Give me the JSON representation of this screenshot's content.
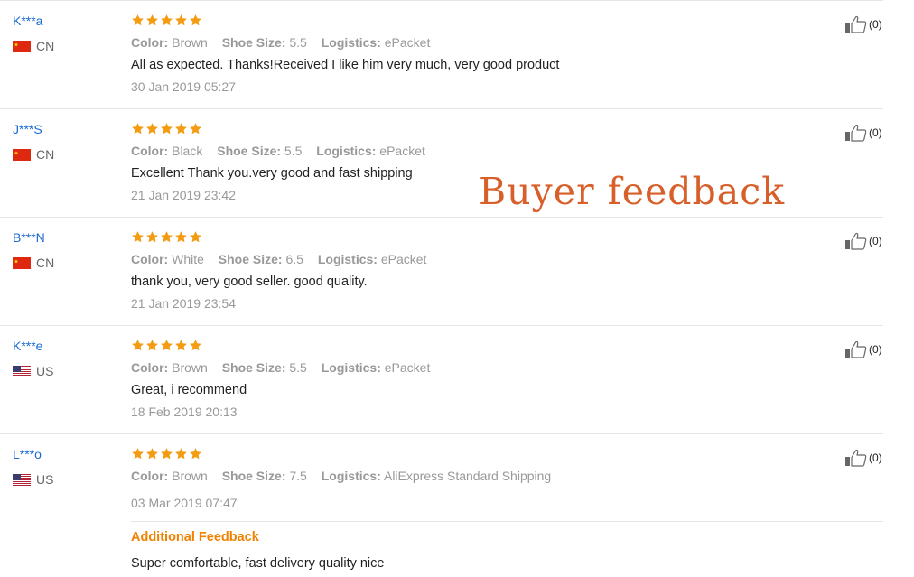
{
  "overlay_title": "Buyer feedback",
  "reviews": [
    {
      "user": "K***a",
      "country": "CN",
      "color": "Brown",
      "size": "5.5",
      "logistics": "ePacket",
      "text": "All as expected. Thanks!Received I like him very much, very good product",
      "date": "30 Jan 2019 05:27",
      "helpful": "(0)"
    },
    {
      "user": "J***S",
      "country": "CN",
      "color": "Black",
      "size": "5.5",
      "logistics": "ePacket",
      "text": "Excellent Thank you.very good and fast shipping",
      "date": "21 Jan 2019 23:42",
      "helpful": "(0)"
    },
    {
      "user": "B***N",
      "country": "CN",
      "color": "White",
      "size": "6.5",
      "logistics": "ePacket",
      "text": "thank you, very good seller. good quality.",
      "date": "21 Jan 2019 23:54",
      "helpful": "(0)"
    },
    {
      "user": "K***e",
      "country": "US",
      "color": "Brown",
      "size": "5.5",
      "logistics": "ePacket",
      "text": "Great, i recommend",
      "date": "18 Feb 2019 20:13",
      "helpful": "(0)"
    },
    {
      "user": "L***o",
      "country": "US",
      "color": "Brown",
      "size": "7.5",
      "logistics": "AliExpress Standard Shipping",
      "text": "",
      "date": "03 Mar 2019 07:47",
      "helpful": "(0)",
      "additional_title": "Additional Feedback",
      "additional_text": "Super comfortable, fast delivery quality nice"
    }
  ],
  "labels": {
    "color": "Color:",
    "size": "Shoe Size:",
    "logistics": "Logistics:"
  },
  "rating_stars": 5,
  "colors": {
    "star": "#f39c12",
    "link": "#1a6ad0",
    "accent": "#f08200",
    "overlay": "#d7602a"
  },
  "icons": {
    "rating": "star-icon",
    "helpful": "thumbs-up-icon"
  }
}
